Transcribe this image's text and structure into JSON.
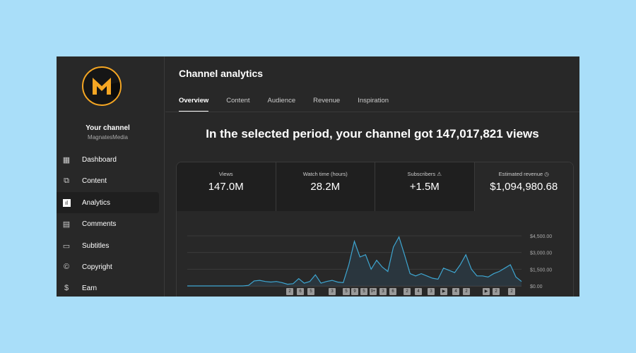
{
  "sidebar": {
    "channel_title": "Your channel",
    "channel_name": "MagnatesMedia",
    "logo_text": "M",
    "items": [
      {
        "label": "Dashboard",
        "icon": "dashboard-icon"
      },
      {
        "label": "Content",
        "icon": "content-icon"
      },
      {
        "label": "Analytics",
        "icon": "analytics-icon",
        "active": true
      },
      {
        "label": "Comments",
        "icon": "comments-icon"
      },
      {
        "label": "Subtitles",
        "icon": "subtitles-icon"
      },
      {
        "label": "Copyright",
        "icon": "copyright-icon"
      },
      {
        "label": "Earn",
        "icon": "earn-icon"
      }
    ]
  },
  "header": {
    "title": "Channel analytics",
    "tabs": [
      {
        "label": "Overview",
        "active": true
      },
      {
        "label": "Content"
      },
      {
        "label": "Audience"
      },
      {
        "label": "Revenue"
      },
      {
        "label": "Inspiration"
      }
    ]
  },
  "headline": "In the selected period, your channel got 147,017,821 views",
  "metrics": [
    {
      "label": "Views",
      "value": "147.0M"
    },
    {
      "label": "Watch time (hours)",
      "value": "28.2M"
    },
    {
      "label": "Subscribers",
      "value": "+1.5M",
      "icon": "warning-icon"
    },
    {
      "label": "Estimated revenue",
      "value": "$1,094,980.68",
      "icon": "clock-icon",
      "highlighted": true
    }
  ],
  "colors": {
    "accent": "#3ea6d1",
    "highlight_ring": "#e01010",
    "logo": "#f5a623"
  },
  "chart_data": {
    "type": "area",
    "title": "",
    "xlabel": "",
    "ylabel": "",
    "ylim": [
      0,
      4500
    ],
    "grid": true,
    "y_ticks": [
      "$4,500.00",
      "$3,000.00",
      "$1,500.00",
      "$0.00"
    ],
    "y_tick_values": [
      4500,
      3000,
      1500,
      0
    ],
    "values": [
      0,
      0,
      0,
      0,
      0,
      0,
      0,
      0,
      0,
      0,
      0,
      50,
      450,
      500,
      400,
      350,
      400,
      300,
      150,
      200,
      650,
      250,
      400,
      1000,
      250,
      400,
      500,
      350,
      300,
      1900,
      4000,
      2600,
      2800,
      1500,
      2300,
      1700,
      1300,
      3500,
      4400,
      2800,
      1100,
      900,
      1100,
      900,
      700,
      600,
      1600,
      1400,
      1200,
      1900,
      2800,
      1500,
      900,
      900,
      800,
      1100,
      1300,
      1600,
      1900,
      800,
      400
    ],
    "markers": [
      "2",
      "6",
      "5",
      "3",
      "5",
      "9",
      "5",
      "9+",
      "3",
      "6",
      "2",
      "4",
      "3",
      "▶",
      "4",
      "2",
      "▶",
      "2",
      "2"
    ]
  }
}
